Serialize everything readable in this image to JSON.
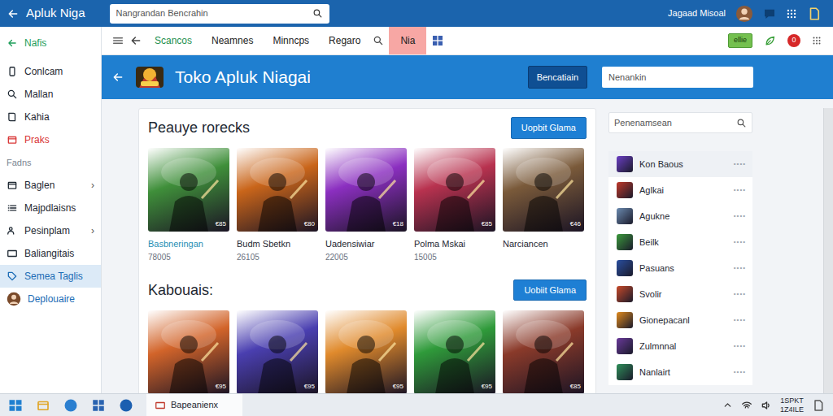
{
  "window": {
    "title": "Apluk Niga"
  },
  "top_search": {
    "placeholder": "Nangrandan Bencrahin"
  },
  "user": {
    "name": "Jagaad Misoal"
  },
  "sidebar": {
    "items": [
      {
        "label": "Nafis",
        "kind": "item",
        "selected": false,
        "color": "#1e9e5a"
      },
      {
        "label": "Conlcam",
        "kind": "item",
        "selected": false,
        "color": "#1f2933"
      },
      {
        "label": "Mallan",
        "kind": "item",
        "selected": false,
        "color": "#1f2933"
      },
      {
        "label": "Kahia",
        "kind": "item",
        "selected": false,
        "color": "#1f2933"
      },
      {
        "label": "Praks",
        "kind": "item",
        "selected": false,
        "color": "#d93636"
      },
      {
        "label": "Fadns",
        "kind": "section",
        "selected": false,
        "color": "#7b8591"
      },
      {
        "label": "Baglen",
        "kind": "item",
        "selected": false,
        "color": "#1f2933",
        "chevron": "›"
      },
      {
        "label": "Majpdlaisns",
        "kind": "item",
        "selected": false,
        "color": "#1f2933"
      },
      {
        "label": "Pesinplam",
        "kind": "item",
        "selected": false,
        "color": "#1f2933",
        "chevron": "›"
      },
      {
        "label": "Baliangitais",
        "kind": "item",
        "selected": false,
        "color": "#1f2933"
      },
      {
        "label": "Semea Taglis",
        "kind": "item",
        "selected": true,
        "color": "#1a6bb5"
      },
      {
        "label": "Deplouaire",
        "kind": "user",
        "selected": false,
        "color": "#1a6bb5"
      }
    ]
  },
  "toolbar": {
    "tabs": [
      {
        "label": "Scancos",
        "selected": false,
        "color": "#1e8f4e"
      },
      {
        "label": "Neamnes",
        "selected": false,
        "color": "#222222"
      },
      {
        "label": "Minncps",
        "selected": false,
        "color": "#222222"
      },
      {
        "label": "Regaro",
        "selected": false,
        "color": "#222222"
      },
      {
        "label": "Nia",
        "selected": true,
        "color": "#222222"
      }
    ],
    "badge": "ellie",
    "notifications": "0"
  },
  "header": {
    "title": "Toko Apluk Niagai",
    "button": "Bencatiain",
    "search": {
      "placeholder": "Nenankin"
    }
  },
  "sections": [
    {
      "title": "Peauye rorecks",
      "button": "Uopbit Glama",
      "games": [
        {
          "name": "Basbneringan",
          "count": "78005",
          "price": "€85",
          "color": "#3f8f3a",
          "selected": true
        },
        {
          "name": "Budm Sbetkn",
          "count": "26105",
          "price": "€80",
          "color": "#c9651a",
          "selected": false
        },
        {
          "name": "Uadensiwiar",
          "count": "22005",
          "price": "€18",
          "color": "#8b2fc0",
          "selected": false
        },
        {
          "name": "Polma Mskai",
          "count": "15005",
          "price": "€85",
          "color": "#b8324f",
          "selected": false
        },
        {
          "name": "Narciancen",
          "price": "€46",
          "color": "#7a5a3a",
          "selected": false
        }
      ]
    },
    {
      "title": "Kabouais:",
      "button": "Uobiit Glama",
      "games": [
        {
          "price": "€95",
          "color": "#d2642a"
        },
        {
          "price": "€95",
          "color": "#4a3fb0"
        },
        {
          "price": "€95",
          "color": "#e08a2c"
        },
        {
          "price": "€95",
          "color": "#2f9a3a"
        },
        {
          "price": "€85",
          "color": "#8a3a2a"
        }
      ]
    }
  ],
  "side_panel": {
    "search": {
      "placeholder": "Penenamsean"
    },
    "items": [
      {
        "name": "Kon Baous",
        "more": "••••",
        "selected": true,
        "color": "#6b3fc4"
      },
      {
        "name": "Aglkai",
        "more": "••••",
        "selected": false,
        "color": "#c0392b"
      },
      {
        "name": "Agukne",
        "more": "••••",
        "selected": false,
        "color": "#6c8bb0"
      },
      {
        "name": "Beilk",
        "more": "••••",
        "selected": false,
        "color": "#3c9a3c"
      },
      {
        "name": "Pasuans",
        "more": "••••",
        "selected": false,
        "color": "#2a4fa0"
      },
      {
        "name": "Svolir",
        "more": "••••",
        "selected": false,
        "color": "#c84a2a"
      },
      {
        "name": "Gionepacanl",
        "more": "••••",
        "selected": false,
        "color": "#e08a1e"
      },
      {
        "name": "Zulmnnal",
        "more": "••••",
        "selected": false,
        "color": "#6a3a9a"
      },
      {
        "name": "Nanlairt",
        "more": "••••",
        "selected": false,
        "color": "#2f8f5a"
      }
    ]
  },
  "taskbar": {
    "app": "Bapeanienx",
    "clock": [
      "1SPKT",
      "1Z4ILE"
    ]
  }
}
